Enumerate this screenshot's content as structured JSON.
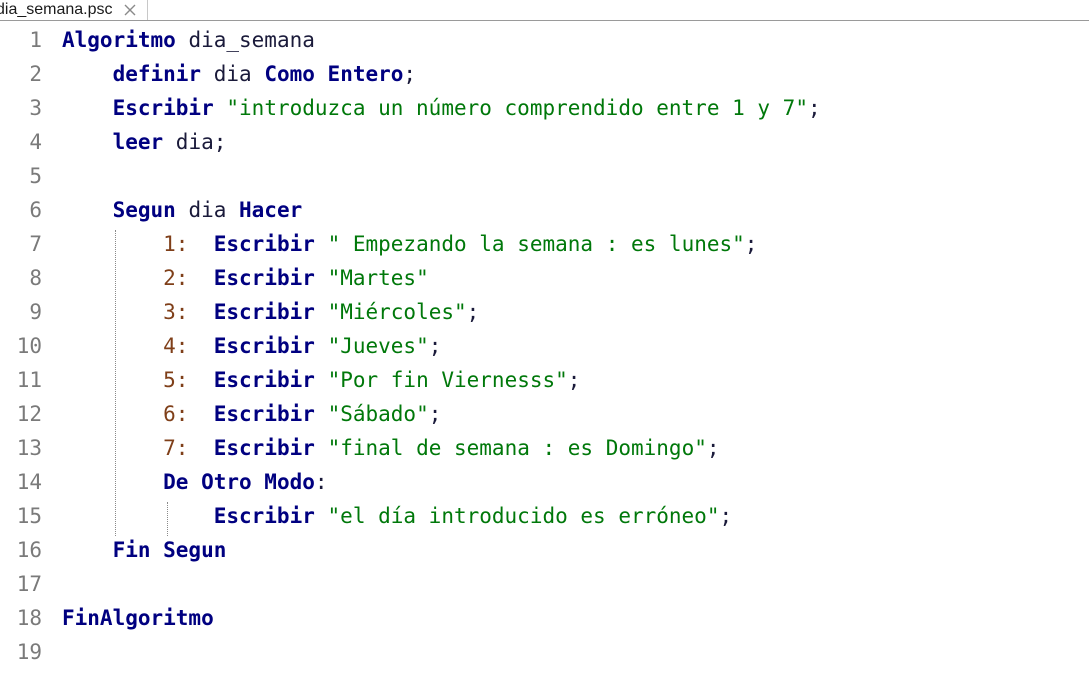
{
  "tab": {
    "title": "dia_semana.psc",
    "close_icon": "close-icon"
  },
  "lines": [
    {
      "n": "1",
      "tokens": [
        {
          "t": "Algoritmo",
          "c": "kw"
        },
        {
          "t": " dia_semana",
          "c": "plain"
        }
      ]
    },
    {
      "n": "2",
      "tokens": [
        {
          "t": "    ",
          "c": "plain"
        },
        {
          "t": "definir",
          "c": "kw"
        },
        {
          "t": " dia ",
          "c": "plain"
        },
        {
          "t": "Como",
          "c": "kw"
        },
        {
          "t": " ",
          "c": "plain"
        },
        {
          "t": "Entero",
          "c": "kw"
        },
        {
          "t": ";",
          "c": "punct"
        }
      ]
    },
    {
      "n": "3",
      "tokens": [
        {
          "t": "    ",
          "c": "plain"
        },
        {
          "t": "Escribir",
          "c": "kw"
        },
        {
          "t": " ",
          "c": "plain"
        },
        {
          "t": "\"introduzca un número comprendido entre 1 y 7\"",
          "c": "str"
        },
        {
          "t": ";",
          "c": "punct"
        }
      ]
    },
    {
      "n": "4",
      "tokens": [
        {
          "t": "    ",
          "c": "plain"
        },
        {
          "t": "leer",
          "c": "kw"
        },
        {
          "t": " dia;",
          "c": "plain"
        }
      ]
    },
    {
      "n": "5",
      "tokens": []
    },
    {
      "n": "6",
      "tokens": [
        {
          "t": "    ",
          "c": "plain"
        },
        {
          "t": "Segun",
          "c": "kw"
        },
        {
          "t": " dia ",
          "c": "plain"
        },
        {
          "t": "Hacer",
          "c": "kw"
        }
      ]
    },
    {
      "n": "7",
      "tokens": [
        {
          "t": "        ",
          "c": "plain"
        },
        {
          "t": "1:",
          "c": "case-label"
        },
        {
          "t": "  ",
          "c": "plain"
        },
        {
          "t": "Escribir",
          "c": "kw"
        },
        {
          "t": " ",
          "c": "plain"
        },
        {
          "t": "\" Empezando la semana : es lunes\"",
          "c": "str"
        },
        {
          "t": ";",
          "c": "punct"
        }
      ]
    },
    {
      "n": "8",
      "tokens": [
        {
          "t": "        ",
          "c": "plain"
        },
        {
          "t": "2:",
          "c": "case-label"
        },
        {
          "t": "  ",
          "c": "plain"
        },
        {
          "t": "Escribir",
          "c": "kw"
        },
        {
          "t": " ",
          "c": "plain"
        },
        {
          "t": "\"Martes\"",
          "c": "str"
        }
      ]
    },
    {
      "n": "9",
      "tokens": [
        {
          "t": "        ",
          "c": "plain"
        },
        {
          "t": "3:",
          "c": "case-label"
        },
        {
          "t": "  ",
          "c": "plain"
        },
        {
          "t": "Escribir",
          "c": "kw"
        },
        {
          "t": " ",
          "c": "plain"
        },
        {
          "t": "\"Miércoles\"",
          "c": "str"
        },
        {
          "t": ";",
          "c": "punct"
        }
      ]
    },
    {
      "n": "10",
      "tokens": [
        {
          "t": "        ",
          "c": "plain"
        },
        {
          "t": "4:",
          "c": "case-label"
        },
        {
          "t": "  ",
          "c": "plain"
        },
        {
          "t": "Escribir",
          "c": "kw"
        },
        {
          "t": " ",
          "c": "plain"
        },
        {
          "t": "\"Jueves\"",
          "c": "str"
        },
        {
          "t": ";",
          "c": "punct"
        }
      ]
    },
    {
      "n": "11",
      "tokens": [
        {
          "t": "        ",
          "c": "plain"
        },
        {
          "t": "5:",
          "c": "case-label"
        },
        {
          "t": "  ",
          "c": "plain"
        },
        {
          "t": "Escribir",
          "c": "kw"
        },
        {
          "t": " ",
          "c": "plain"
        },
        {
          "t": "\"Por fin Viernesss\"",
          "c": "str"
        },
        {
          "t": ";",
          "c": "punct"
        }
      ]
    },
    {
      "n": "12",
      "tokens": [
        {
          "t": "        ",
          "c": "plain"
        },
        {
          "t": "6:",
          "c": "case-label"
        },
        {
          "t": "  ",
          "c": "plain"
        },
        {
          "t": "Escribir",
          "c": "kw"
        },
        {
          "t": " ",
          "c": "plain"
        },
        {
          "t": "\"Sábado\"",
          "c": "str"
        },
        {
          "t": ";",
          "c": "punct"
        }
      ]
    },
    {
      "n": "13",
      "tokens": [
        {
          "t": "        ",
          "c": "plain"
        },
        {
          "t": "7:",
          "c": "case-label"
        },
        {
          "t": "  ",
          "c": "plain"
        },
        {
          "t": "Escribir",
          "c": "kw"
        },
        {
          "t": " ",
          "c": "plain"
        },
        {
          "t": "\"final de semana : es Domingo\"",
          "c": "str"
        },
        {
          "t": ";",
          "c": "punct"
        }
      ]
    },
    {
      "n": "14",
      "tokens": [
        {
          "t": "        ",
          "c": "plain"
        },
        {
          "t": "De Otro Modo",
          "c": "kw"
        },
        {
          "t": ":",
          "c": "punct"
        }
      ]
    },
    {
      "n": "15",
      "tokens": [
        {
          "t": "            ",
          "c": "plain"
        },
        {
          "t": "Escribir",
          "c": "kw"
        },
        {
          "t": " ",
          "c": "plain"
        },
        {
          "t": "\"el día introducido es erróneo\"",
          "c": "str"
        },
        {
          "t": ";",
          "c": "punct"
        }
      ]
    },
    {
      "n": "16",
      "tokens": [
        {
          "t": "    ",
          "c": "plain"
        },
        {
          "t": "Fin Segun",
          "c": "kw"
        }
      ]
    },
    {
      "n": "17",
      "tokens": []
    },
    {
      "n": "18",
      "tokens": [
        {
          "t": "FinAlgoritmo",
          "c": "kw"
        }
      ]
    },
    {
      "n": "19",
      "tokens": []
    }
  ],
  "colors": {
    "keyword": "#000080",
    "string": "#00780a",
    "case_label": "#7f3f19",
    "line_number": "#7a7a7a"
  }
}
